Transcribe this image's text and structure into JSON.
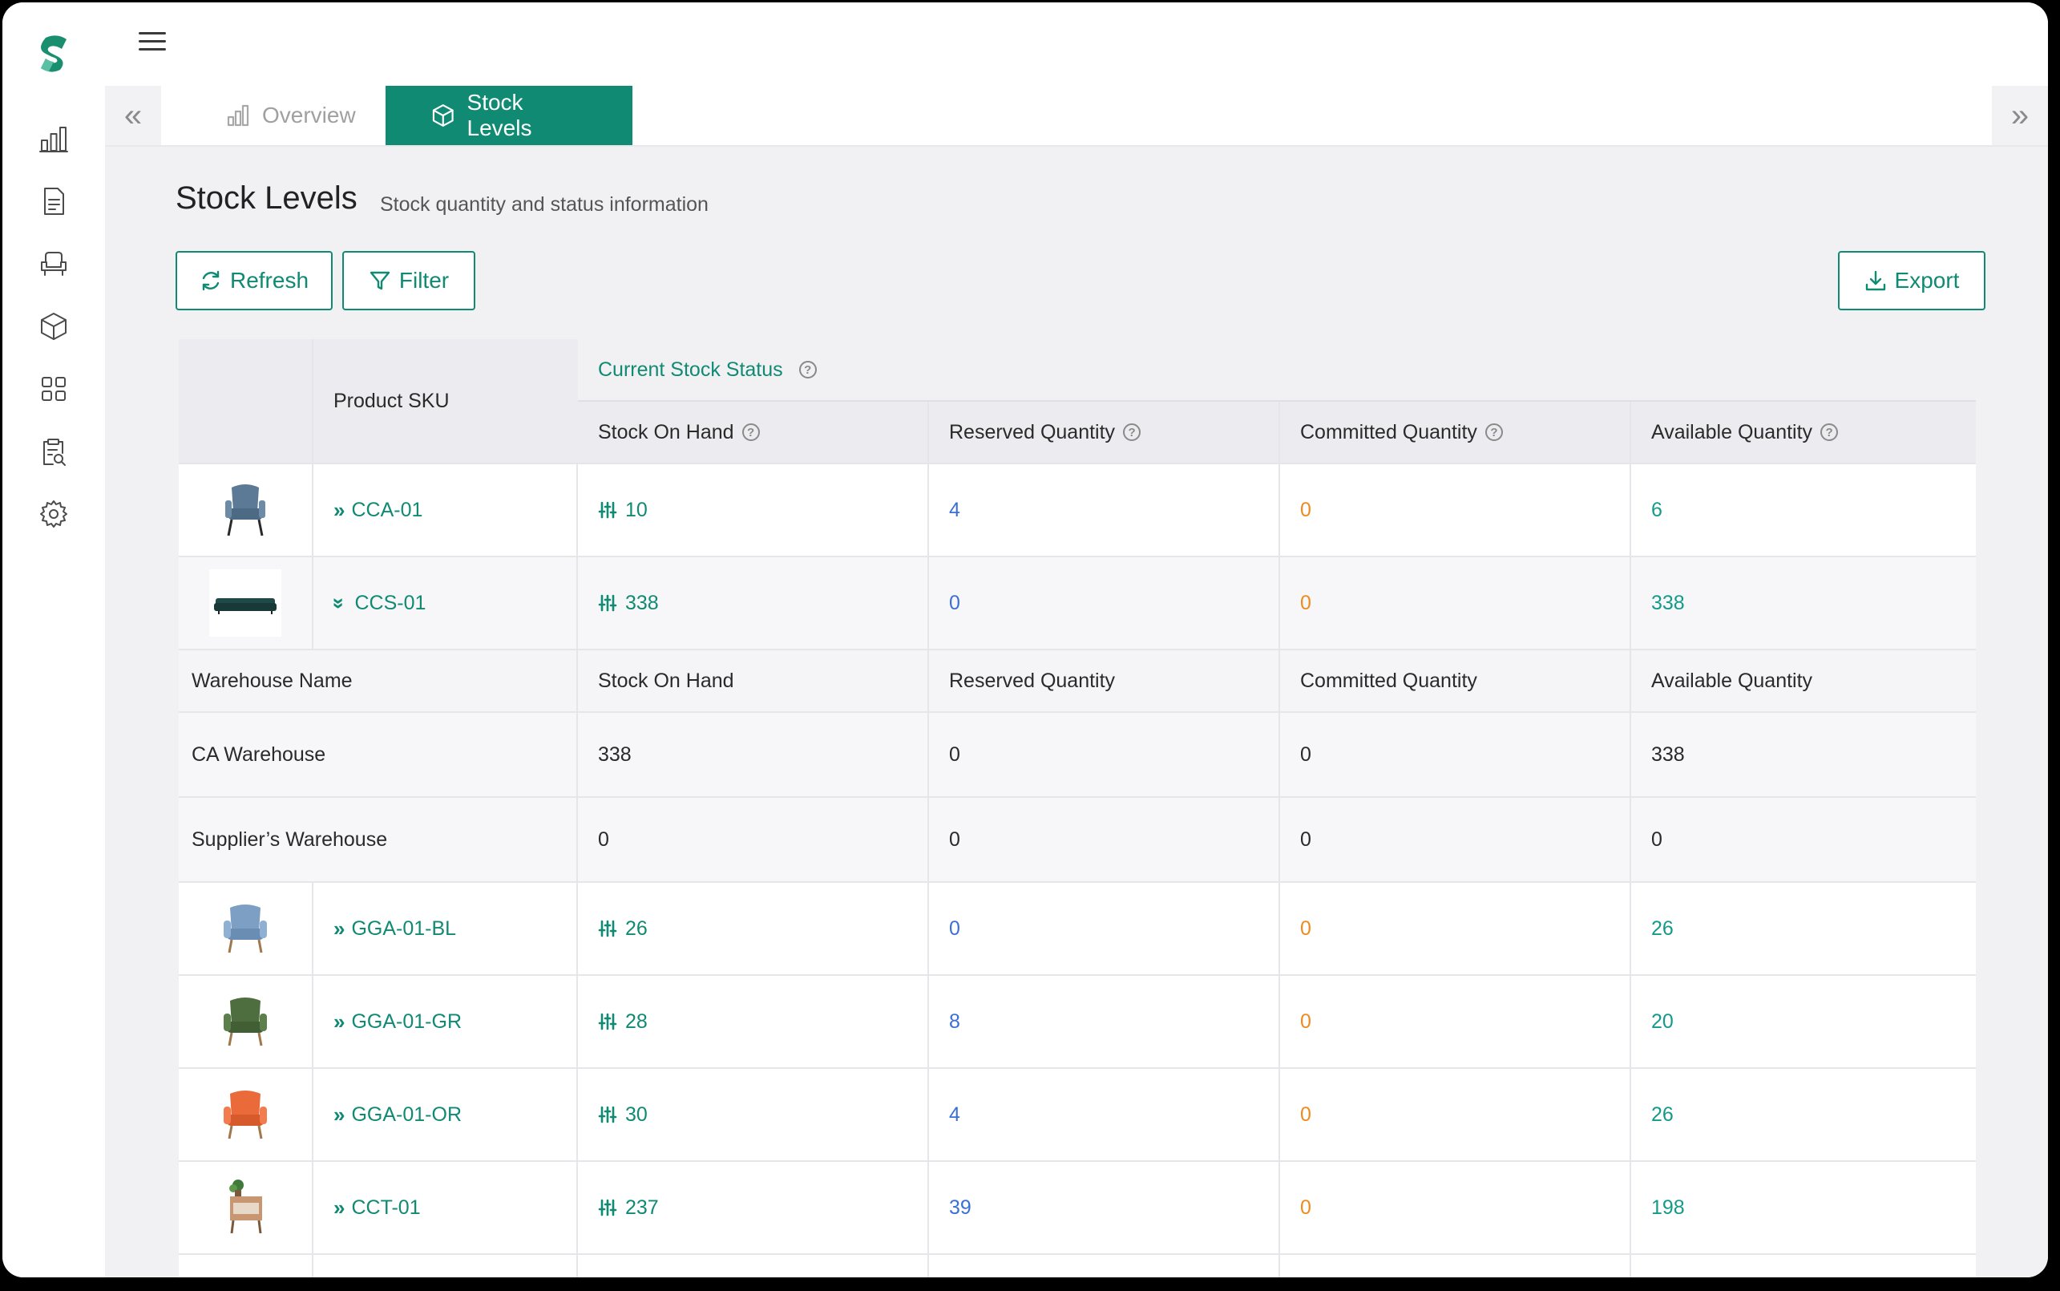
{
  "sidebar": {
    "icons": [
      "logo-icon",
      "analytics-icon",
      "document-icon",
      "furniture-icon",
      "package-icon",
      "apps-icon",
      "clipboard-search-icon",
      "settings-icon"
    ]
  },
  "tabs": [
    {
      "label": "Overview",
      "icon": "bar-chart-icon",
      "active": false
    },
    {
      "label": "Stock Levels",
      "icon": "package-icon",
      "active": true
    }
  ],
  "page": {
    "title": "Stock Levels",
    "subtitle": "Stock quantity and status information"
  },
  "toolbar": {
    "refresh_label": "Refresh",
    "filter_label": "Filter",
    "export_label": "Export"
  },
  "table": {
    "sku_header": "Product SKU",
    "group_header": "Current Stock Status",
    "columns": {
      "soh": "Stock On Hand",
      "reserved": "Reserved Quantity",
      "committed": "Committed Quantity",
      "available": "Available Quantity"
    },
    "rows": [
      {
        "sku": "CCA-01",
        "expanded": false,
        "soh": "10",
        "reserved": "4",
        "committed": "0",
        "available": "6",
        "thumb_color": "#5c7a96"
      },
      {
        "sku": "CCS-01",
        "expanded": true,
        "soh": "338",
        "reserved": "0",
        "committed": "0",
        "available": "338",
        "thumb_color": "#1f4a48"
      },
      {
        "sku": "GGA-01-BL",
        "expanded": false,
        "soh": "26",
        "reserved": "0",
        "committed": "0",
        "available": "26",
        "thumb_color": "#7d9fc4"
      },
      {
        "sku": "GGA-01-GR",
        "expanded": false,
        "soh": "28",
        "reserved": "8",
        "committed": "0",
        "available": "20",
        "thumb_color": "#4f6e3f"
      },
      {
        "sku": "GGA-01-OR",
        "expanded": false,
        "soh": "30",
        "reserved": "4",
        "committed": "0",
        "available": "26",
        "thumb_color": "#ea6a3a"
      },
      {
        "sku": "CCT-01",
        "expanded": false,
        "soh": "237",
        "reserved": "39",
        "committed": "0",
        "available": "198",
        "thumb_color": "#c89670"
      }
    ],
    "warehouse": {
      "headers": {
        "name": "Warehouse Name",
        "soh": "Stock On Hand",
        "reserved": "Reserved Quantity",
        "committed": "Committed Quantity",
        "available": "Available Quantity"
      },
      "rows": [
        {
          "name": "CA Warehouse",
          "soh": "338",
          "reserved": "0",
          "committed": "0",
          "available": "338"
        },
        {
          "name": "Supplier’s Warehouse",
          "soh": "0",
          "reserved": "0",
          "committed": "0",
          "available": "0"
        }
      ]
    }
  },
  "colors": {
    "accent": "#108a73",
    "reserved": "#3b6fd6",
    "committed": "#ef8a1e",
    "available": "#139a8a"
  }
}
